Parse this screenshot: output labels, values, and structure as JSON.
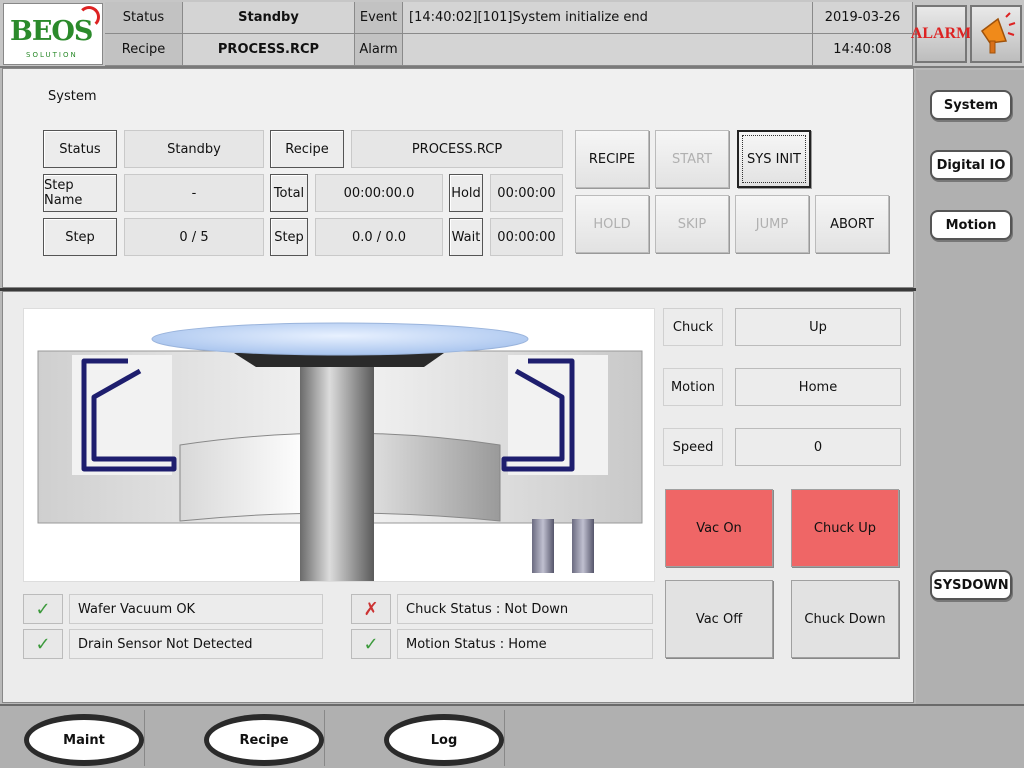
{
  "header": {
    "logo_text": "BEOS",
    "logo_sub": "SOLUTION",
    "status_label": "Status",
    "status_value": "Standby",
    "recipe_label": "Recipe",
    "recipe_value": "PROCESS.RCP",
    "event_label": "Event",
    "event_value": "[14:40:02][101]System initialize end",
    "alarm_label": "Alarm",
    "alarm_value": "",
    "date": "2019-03-26",
    "time": "14:40:08",
    "alarm_button": "ALARM"
  },
  "system": {
    "title": "System",
    "status_label": "Status",
    "status_value": "Standby",
    "recipe_label": "Recipe",
    "recipe_value": "PROCESS.RCP",
    "step_name_label": "Step Name",
    "step_name_value": "-",
    "total_label": "Total",
    "total_value": "00:00:00.0",
    "hold_label": "Hold",
    "hold_value": "00:00:00",
    "step_label": "Step",
    "step_value": "0 / 5",
    "step2_label": "Step",
    "step2_value": "0.0 / 0.0",
    "wait_label": "Wait",
    "wait_value": "00:00:00",
    "buttons": {
      "recipe": "RECIPE",
      "start": "START",
      "sys_init": "SYS INIT",
      "hold": "HOLD",
      "skip": "SKIP",
      "jump": "JUMP",
      "abort": "ABORT"
    }
  },
  "chuck": {
    "chuck_label": "Chuck",
    "chuck_value": "Up",
    "motion_label": "Motion",
    "motion_value": "Home",
    "speed_label": "Speed",
    "speed_value": "0",
    "vac_on": "Vac On",
    "chuck_up": "Chuck Up",
    "vac_off": "Vac Off",
    "chuck_down": "Chuck Down"
  },
  "status_items": [
    {
      "text": "Wafer Vacuum OK",
      "state": "ok"
    },
    {
      "text": "Drain Sensor Not Detected",
      "state": "ok"
    },
    {
      "text": "Chuck Status : Not Down",
      "state": "ng"
    },
    {
      "text": "Motion Status : Home",
      "state": "ok"
    }
  ],
  "sidebar": {
    "system": "System",
    "digital_io": "Digital IO",
    "motion": "Motion",
    "sysdown": "SYSDOWN"
  },
  "footer": {
    "maint": "Maint",
    "recipe": "Recipe",
    "log": "Log"
  },
  "colors": {
    "red_button": "#ef6666",
    "ok_check": "#3c9a3c",
    "ng_cross": "#c33333",
    "wafer": "#b6cff2",
    "chuck_frame": "#1e1e6e"
  }
}
